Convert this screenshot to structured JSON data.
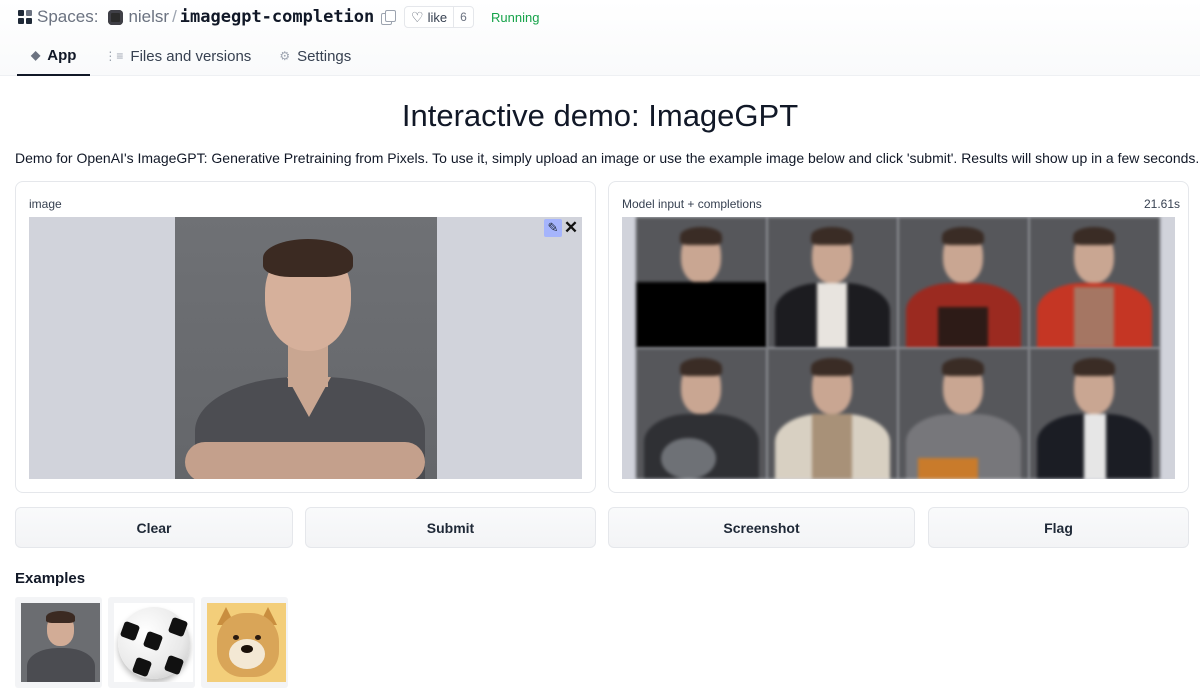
{
  "header": {
    "spaces_label": "Spaces:",
    "owner": "nielsr",
    "separator": "/",
    "repo": "imagegpt-completion",
    "like_label": "like",
    "like_count": "6",
    "status": "Running",
    "status_color": "#16a34a"
  },
  "tabs": [
    {
      "label": "App",
      "icon": "cube-icon",
      "active": true
    },
    {
      "label": "Files and versions",
      "icon": "files-icon",
      "active": false
    },
    {
      "label": "Settings",
      "icon": "gear-icon",
      "active": false
    }
  ],
  "main": {
    "title": "Interactive demo: ImageGPT",
    "description": "Demo for OpenAI's ImageGPT: Generative Pretraining from Pixels. To use it, simply upload an image or use the example image below and click 'submit'. Results will show up in a few seconds."
  },
  "input_panel": {
    "label": "image",
    "edit_icon": "pencil-icon",
    "close_icon": "close-icon"
  },
  "output_panel": {
    "label": "Model input + completions",
    "timer": "21.61s"
  },
  "buttons": {
    "clear": "Clear",
    "submit": "Submit",
    "screenshot": "Screenshot",
    "flag": "Flag"
  },
  "examples": {
    "title": "Examples",
    "items": [
      "portrait-photo",
      "soccer-ball-photo",
      "doge-photo"
    ]
  }
}
